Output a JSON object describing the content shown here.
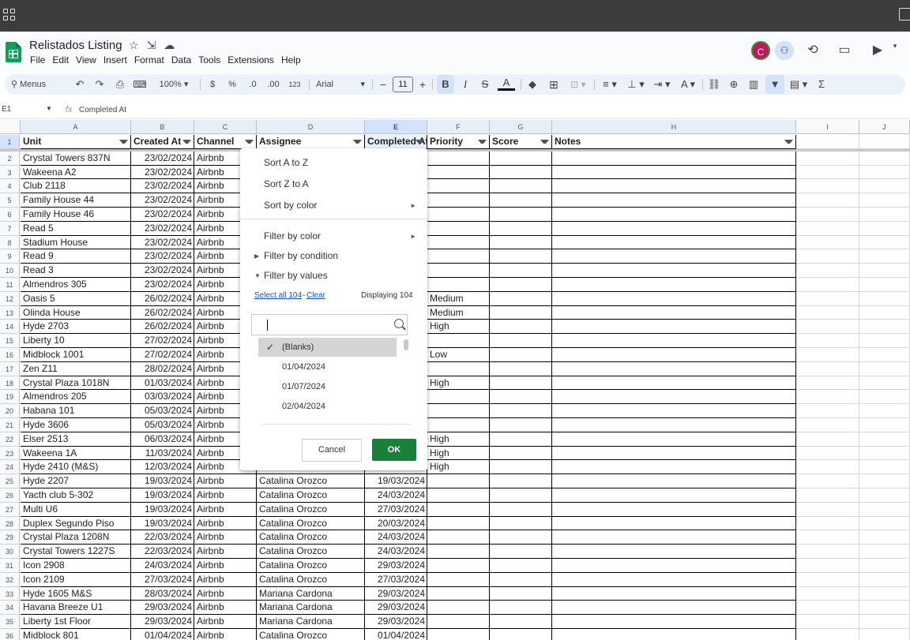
{
  "app": {
    "doc_title": "Relistados Listing",
    "menu": [
      "File",
      "Edit",
      "View",
      "Insert",
      "Format",
      "Data",
      "Tools",
      "Extensions",
      "Help"
    ],
    "avatar_initial": "C"
  },
  "toolbar": {
    "menus_label": "Menus",
    "zoom": "100%",
    "currency": "$",
    "percent": "%",
    "dec_decrease": ".0",
    "dec_increase": ".00",
    "number_format": "123",
    "font": "Arial",
    "font_size": "11",
    "bold": "B",
    "italic": "I",
    "strike": "S",
    "text_color": "A",
    "sum": "Σ"
  },
  "formula_bar": {
    "cell_ref": "E1",
    "fx": "fx",
    "value": "Completed At"
  },
  "columns": [
    "A",
    "B",
    "C",
    "D",
    "E",
    "F",
    "G",
    "H",
    "I",
    "J"
  ],
  "headers": [
    "Unit",
    "Created At",
    "Channel",
    "Assignee",
    "Completed At",
    "Priority",
    "Score",
    "Notes"
  ],
  "rows": [
    {
      "n": "2",
      "unit": "Crystal Towers 837N",
      "created": "23/02/2024",
      "channel": "Airbnb",
      "assignee": "",
      "completed": "",
      "priority": ""
    },
    {
      "n": "3",
      "unit": "Wakeena A2",
      "created": "23/02/2024",
      "channel": "Airbnb",
      "assignee": "",
      "completed": "",
      "priority": ""
    },
    {
      "n": "4",
      "unit": "Club 2118",
      "created": "23/02/2024",
      "channel": "Airbnb",
      "assignee": "",
      "completed": "",
      "priority": ""
    },
    {
      "n": "5",
      "unit": "Family House 44",
      "created": "23/02/2024",
      "channel": "Airbnb",
      "assignee": "",
      "completed": "",
      "priority": ""
    },
    {
      "n": "6",
      "unit": "Family House 46",
      "created": "23/02/2024",
      "channel": "Airbnb",
      "assignee": "",
      "completed": "",
      "priority": ""
    },
    {
      "n": "7",
      "unit": "Read 5",
      "created": "23/02/2024",
      "channel": "Airbnb",
      "assignee": "",
      "completed": "",
      "priority": ""
    },
    {
      "n": "8",
      "unit": "Stadium House",
      "created": "23/02/2024",
      "channel": "Airbnb",
      "assignee": "",
      "completed": "",
      "priority": ""
    },
    {
      "n": "9",
      "unit": "Read 9",
      "created": "23/02/2024",
      "channel": "Airbnb",
      "assignee": "",
      "completed": "",
      "priority": ""
    },
    {
      "n": "10",
      "unit": "Read 3",
      "created": "23/02/2024",
      "channel": "Airbnb",
      "assignee": "",
      "completed": "",
      "priority": ""
    },
    {
      "n": "11",
      "unit": "Almendros 305",
      "created": "23/02/2024",
      "channel": "Airbnb",
      "assignee": "",
      "completed": "",
      "priority": ""
    },
    {
      "n": "12",
      "unit": "Oasis 5",
      "created": "26/02/2024",
      "channel": "Airbnb",
      "assignee": "",
      "completed": "",
      "priority": "Medium"
    },
    {
      "n": "13",
      "unit": "Olinda House",
      "created": "26/02/2024",
      "channel": "Airbnb",
      "assignee": "",
      "completed": "",
      "priority": "Medium"
    },
    {
      "n": "14",
      "unit": "Hyde 2703",
      "created": "26/02/2024",
      "channel": "Airbnb",
      "assignee": "",
      "completed": "",
      "priority": "High"
    },
    {
      "n": "15",
      "unit": "Liberty 10",
      "created": "27/02/2024",
      "channel": "Airbnb",
      "assignee": "",
      "completed": "",
      "priority": ""
    },
    {
      "n": "16",
      "unit": "Midblock 1001",
      "created": "27/02/2024",
      "channel": "Airbnb",
      "assignee": "",
      "completed": "",
      "priority": "Low"
    },
    {
      "n": "17",
      "unit": "Zen Z11",
      "created": "28/02/2024",
      "channel": "Airbnb",
      "assignee": "",
      "completed": "",
      "priority": ""
    },
    {
      "n": "18",
      "unit": "Crystal Plaza 1018N",
      "created": "01/03/2024",
      "channel": "Airbnb",
      "assignee": "",
      "completed": "",
      "priority": "High"
    },
    {
      "n": "19",
      "unit": "Almendros 205",
      "created": "03/03/2024",
      "channel": "Airbnb",
      "assignee": "",
      "completed": "",
      "priority": ""
    },
    {
      "n": "20",
      "unit": "Habana 101",
      "created": "05/03/2024",
      "channel": "Airbnb",
      "assignee": "",
      "completed": "",
      "priority": ""
    },
    {
      "n": "21",
      "unit": "Hyde 3606",
      "created": "05/03/2024",
      "channel": "Airbnb",
      "assignee": "",
      "completed": "",
      "priority": ""
    },
    {
      "n": "22",
      "unit": "Elser 2513",
      "created": "06/03/2024",
      "channel": "Airbnb",
      "assignee": "",
      "completed": "",
      "priority": "High"
    },
    {
      "n": "23",
      "unit": "Wakeena 1A",
      "created": "11/03/2024",
      "channel": "Airbnb",
      "assignee": "",
      "completed": "",
      "priority": "High"
    },
    {
      "n": "24",
      "unit": "Hyde 2410 (M&S)",
      "created": "12/03/2024",
      "channel": "Airbnb",
      "assignee": "",
      "completed": "",
      "priority": "High"
    },
    {
      "n": "25",
      "unit": "Hyde 2207",
      "created": "19/03/2024",
      "channel": "Airbnb",
      "assignee": "Catalina Orozco",
      "completed": "19/03/2024",
      "priority": ""
    },
    {
      "n": "26",
      "unit": "Yacth club 5-302",
      "created": "19/03/2024",
      "channel": "Airbnb",
      "assignee": "Catalina Orozco",
      "completed": "24/03/2024",
      "priority": ""
    },
    {
      "n": "27",
      "unit": "Multi U6",
      "created": "19/03/2024",
      "channel": "Airbnb",
      "assignee": "Catalina Orozco",
      "completed": "27/03/2024",
      "priority": ""
    },
    {
      "n": "28",
      "unit": "Duplex Segundo Piso",
      "created": "19/03/2024",
      "channel": "Airbnb",
      "assignee": "Catalina Orozco",
      "completed": "20/03/2024",
      "priority": ""
    },
    {
      "n": "29",
      "unit": "Crystal Plaza 1208N",
      "created": "22/03/2024",
      "channel": "Airbnb",
      "assignee": "Catalina Orozco",
      "completed": "24/03/2024",
      "priority": ""
    },
    {
      "n": "30",
      "unit": "Crystal Towers 1227S",
      "created": "22/03/2024",
      "channel": "Airbnb",
      "assignee": "Catalina Orozco",
      "completed": "24/03/2024",
      "priority": ""
    },
    {
      "n": "31",
      "unit": "Icon 2908",
      "created": "24/03/2024",
      "channel": "Airbnb",
      "assignee": "Catalina Orozco",
      "completed": "29/03/2024",
      "priority": ""
    },
    {
      "n": "32",
      "unit": "Icon 2109",
      "created": "27/03/2024",
      "channel": "Airbnb",
      "assignee": "Catalina Orozco",
      "completed": "27/03/2024",
      "priority": ""
    },
    {
      "n": "33",
      "unit": "Hyde 1605 M&S",
      "created": "28/03/2024",
      "channel": "Airbnb",
      "assignee": "Mariana Cardona",
      "completed": "29/03/2024",
      "priority": ""
    },
    {
      "n": "34",
      "unit": "Havana Breeze U1",
      "created": "29/03/2024",
      "channel": "Airbnb",
      "assignee": "Mariana Cardona",
      "completed": "29/03/2024",
      "priority": ""
    },
    {
      "n": "35",
      "unit": "Liberty 1st Floor",
      "created": "29/03/2024",
      "channel": "Airbnb",
      "assignee": "Mariana Cardona",
      "completed": "29/03/2024",
      "priority": ""
    },
    {
      "n": "36",
      "unit": "Midblock 801",
      "created": "01/04/2024",
      "channel": "Airbnb",
      "assignee": "Catalina Orozco",
      "completed": "01/04/2024",
      "priority": ""
    }
  ],
  "filter_menu": {
    "sort_az": "Sort A to Z",
    "sort_za": "Sort Z to A",
    "sort_color": "Sort by color",
    "filter_color": "Filter by color",
    "filter_condition": "Filter by condition",
    "filter_values": "Filter by values",
    "select_all": "Select all 104",
    "dash": "-",
    "clear": "Clear",
    "displaying": "Displaying 104",
    "values": [
      "(Blanks)",
      "01/04/2024",
      "01/07/2024",
      "02/04/2024"
    ],
    "checked_value": "(Blanks)",
    "cancel": "Cancel",
    "ok": "OK"
  },
  "colors": {
    "topbar": "#3c3c3c",
    "toolbar_bg": "#edf2fa",
    "ok_green": "#188038",
    "link_blue": "#1155cc",
    "avatar": "#c2185b"
  }
}
